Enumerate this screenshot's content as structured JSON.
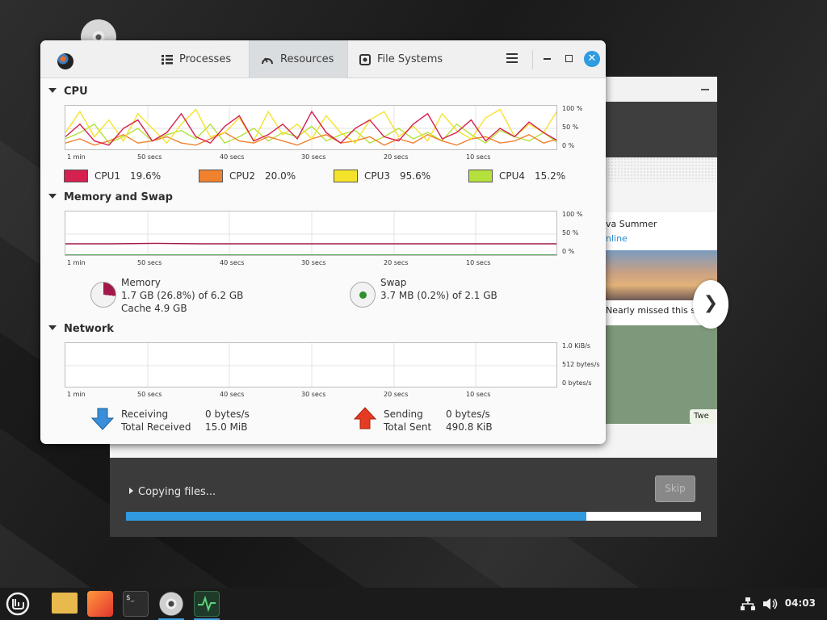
{
  "installer": {
    "card_name": "va Summer",
    "card_status": "nline",
    "card_caption": "Nearly missed this s",
    "card_tweet": "Twe",
    "next_glyph": "❯",
    "status_text": "Copying files...",
    "skip_label": "Skip",
    "progress_fraction": 0.8,
    "progress_color": "#3199de"
  },
  "sysmon": {
    "tabs": [
      {
        "label": "Processes",
        "icon": "list-icon"
      },
      {
        "label": "Resources",
        "icon": "gauge-icon",
        "active": true
      },
      {
        "label": "File Systems",
        "icon": "disk-icon"
      }
    ],
    "close_glyph": "✕",
    "cpu": {
      "title": "CPU",
      "y_ticks": [
        "100 %",
        "50 %",
        "0 %"
      ],
      "x_ticks": [
        "1 min",
        "50 secs",
        "40 secs",
        "30 secs",
        "20 secs",
        "10 secs"
      ],
      "cores": [
        {
          "label": "CPU1",
          "value": "19.6%",
          "color": "#d6204f"
        },
        {
          "label": "CPU2",
          "value": "20.0%",
          "color": "#f0812f"
        },
        {
          "label": "CPU3",
          "value": "95.6%",
          "color": "#f5e32a"
        },
        {
          "label": "CPU4",
          "value": "15.2%",
          "color": "#b5e13c"
        }
      ]
    },
    "memory": {
      "title": "Memory and Swap",
      "y_ticks": [
        "100 %",
        "50 %",
        "0 %"
      ],
      "x_ticks": [
        "1 min",
        "50 secs",
        "40 secs",
        "30 secs",
        "20 secs",
        "10 secs"
      ],
      "mem_label": "Memory",
      "mem_usage": "1.7 GB (26.8%) of 6.2 GB",
      "mem_cache": "Cache 4.9 GB",
      "mem_color": "#a3184a",
      "swap_label": "Swap",
      "swap_usage": "3.7 MB (0.2%) of 2.1 GB",
      "swap_color": "#2f8f2f"
    },
    "network": {
      "title": "Network",
      "y_ticks": [
        "1.0 KiB/s",
        "512 bytes/s",
        "0 bytes/s"
      ],
      "x_ticks": [
        "1 min",
        "50 secs",
        "40 secs",
        "30 secs",
        "20 secs",
        "10 secs"
      ],
      "receiving_label": "Receiving",
      "receiving_value": "0 bytes/s",
      "total_received_label": "Total Received",
      "total_received_value": "15.0 MiB",
      "sending_label": "Sending",
      "sending_value": "0 bytes/s",
      "total_sent_label": "Total Sent",
      "total_sent_value": "490.8 KiB"
    }
  },
  "taskbar": {
    "items": [
      "mint-menu-icon",
      "folder-icon",
      "firefox-icon",
      "terminal-icon",
      "installer-disc-icon",
      "system-monitor-icon"
    ],
    "clock": "04:03"
  },
  "chart_data": {
    "type": "line",
    "x_ticks": [
      "1 min",
      "50 secs",
      "40 secs",
      "30 secs",
      "20 secs",
      "10 secs"
    ],
    "ylim": [
      0,
      100
    ],
    "series": [
      {
        "name": "CPU1",
        "values": [
          30,
          60,
          20,
          10,
          50,
          70,
          20,
          40,
          85,
          30,
          15,
          55,
          80,
          20,
          35,
          60,
          25,
          90,
          40,
          15,
          50,
          70,
          30,
          20,
          60,
          85,
          25,
          40,
          70,
          20,
          50,
          30,
          65,
          40,
          20
        ]
      },
      {
        "name": "CPU2",
        "values": [
          15,
          25,
          10,
          20,
          35,
          15,
          20,
          30,
          15,
          10,
          25,
          40,
          20,
          15,
          30,
          20,
          10,
          25,
          35,
          15,
          20,
          30,
          10,
          25,
          15,
          35,
          20,
          10,
          25,
          30,
          15,
          20,
          35,
          15,
          25
        ]
      },
      {
        "name": "CPU3",
        "values": [
          40,
          90,
          30,
          70,
          20,
          85,
          50,
          15,
          60,
          95,
          30,
          40,
          75,
          20,
          90,
          35,
          60,
          25,
          80,
          40,
          15,
          70,
          90,
          30,
          55,
          20,
          85,
          45,
          25,
          75,
          95,
          30,
          60,
          40,
          95
        ]
      },
      {
        "name": "CPU4",
        "values": [
          25,
          40,
          60,
          15,
          30,
          50,
          20,
          35,
          45,
          25,
          60,
          15,
          30,
          50,
          20,
          40,
          30,
          55,
          20,
          35,
          45,
          15,
          30,
          50,
          25,
          40,
          20,
          60,
          35,
          15,
          45,
          30,
          20,
          40,
          15
        ]
      },
      {
        "name": "Memory",
        "values": [
          27,
          27,
          28,
          27,
          27,
          27,
          27,
          27,
          27,
          27,
          27,
          27
        ]
      },
      {
        "name": "Swap",
        "values": [
          0,
          0,
          0,
          0,
          0,
          0,
          0,
          0,
          0,
          0,
          0,
          0
        ]
      }
    ]
  }
}
